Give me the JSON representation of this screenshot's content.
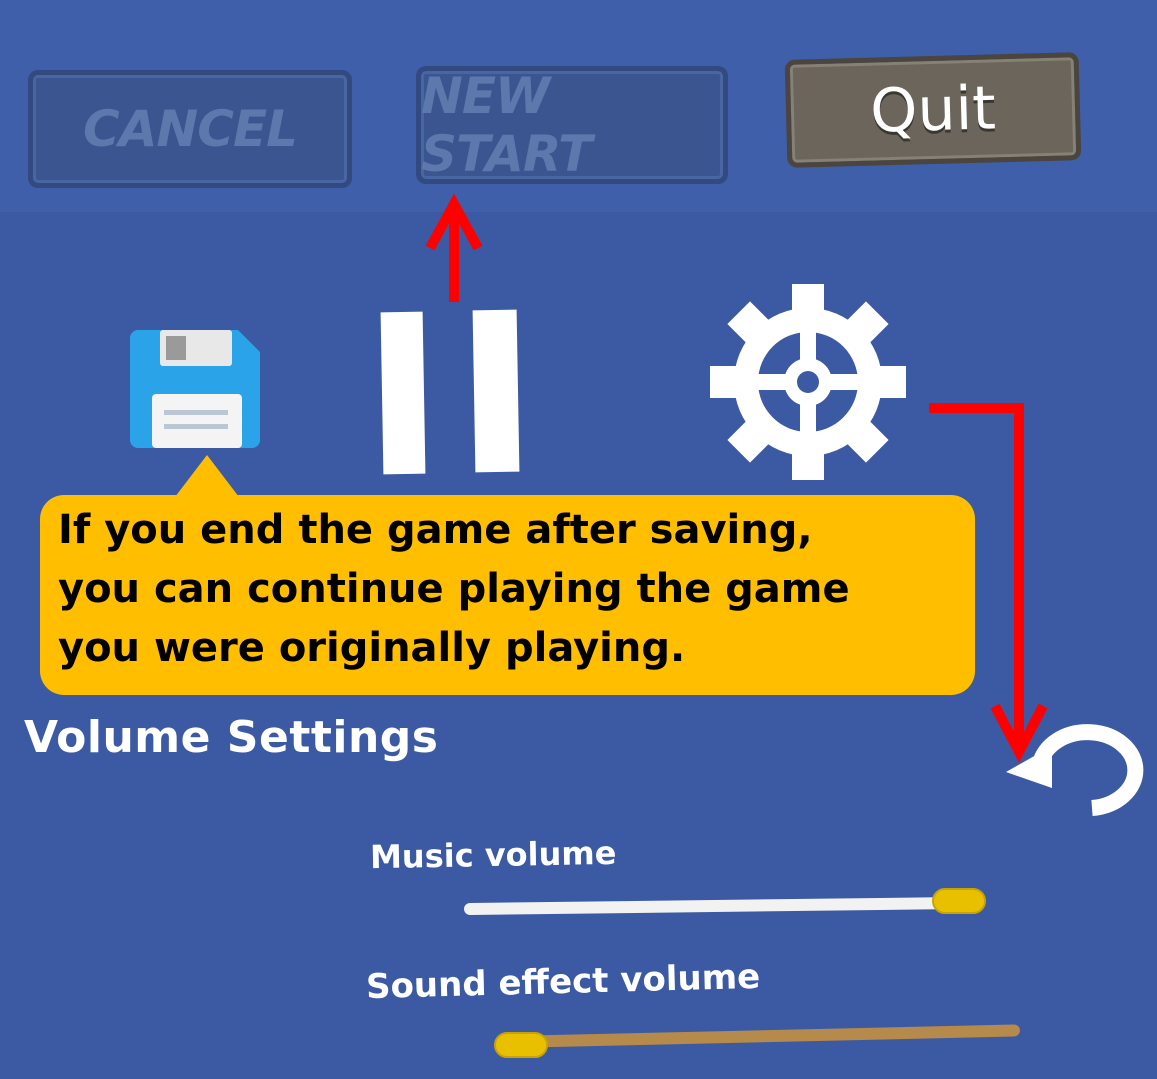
{
  "top_buttons": {
    "cancel_label": "CANCEL",
    "new_start_label": "NEW START",
    "quit_label": "Quit"
  },
  "icons": {
    "save": "floppy-disk-icon",
    "pause": "pause-icon",
    "settings": "gear-icon",
    "back": "undo-arrow-icon"
  },
  "callout": {
    "lines": [
      "If you end the game after saving,",
      "you can continue playing the game",
      "you were originally playing."
    ]
  },
  "volume": {
    "title": "Volume Settings",
    "music_label": "Music volume",
    "music_level": 1.0,
    "sfx_label": "Sound effect volume",
    "sfx_level": 0.0
  },
  "colors": {
    "background": "#3c5aa3",
    "callout": "#ffbf00",
    "arrow": "#ff0000",
    "knob": "#e8c000"
  }
}
